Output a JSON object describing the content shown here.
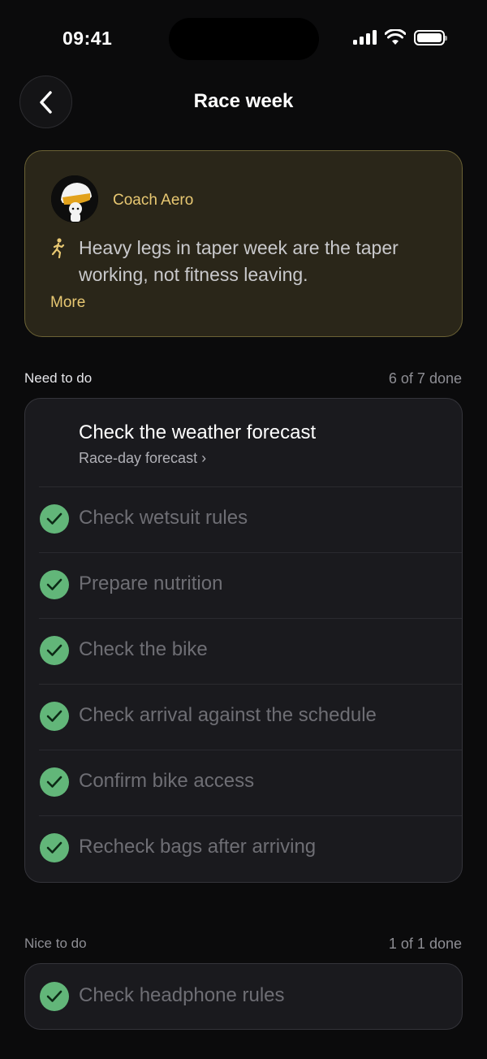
{
  "status_bar": {
    "time": "09:41"
  },
  "header": {
    "title": "Race week"
  },
  "coach": {
    "name": "Coach Aero",
    "message": "Heavy legs in taper week are the taper working, not fitness leaving.",
    "more_label": "More"
  },
  "need_to_do": {
    "label": "Need to do",
    "count": "6 of 7 done",
    "pending": {
      "title": "Check the weather forecast",
      "link": "Race-day forecast ›"
    },
    "done_items": [
      {
        "label": "Check wetsuit rules"
      },
      {
        "label": "Prepare nutrition"
      },
      {
        "label": "Check the bike"
      },
      {
        "label": "Check arrival against the schedule"
      },
      {
        "label": "Confirm bike access"
      },
      {
        "label": "Recheck bags after arriving"
      }
    ]
  },
  "nice_to_do": {
    "label": "Nice to do",
    "count": "1 of 1 done",
    "done_items": [
      {
        "label": "Check headphone rules"
      }
    ]
  },
  "colors": {
    "accent": "#e8c872",
    "check": "#62b679",
    "background": "#0b0b0c"
  }
}
